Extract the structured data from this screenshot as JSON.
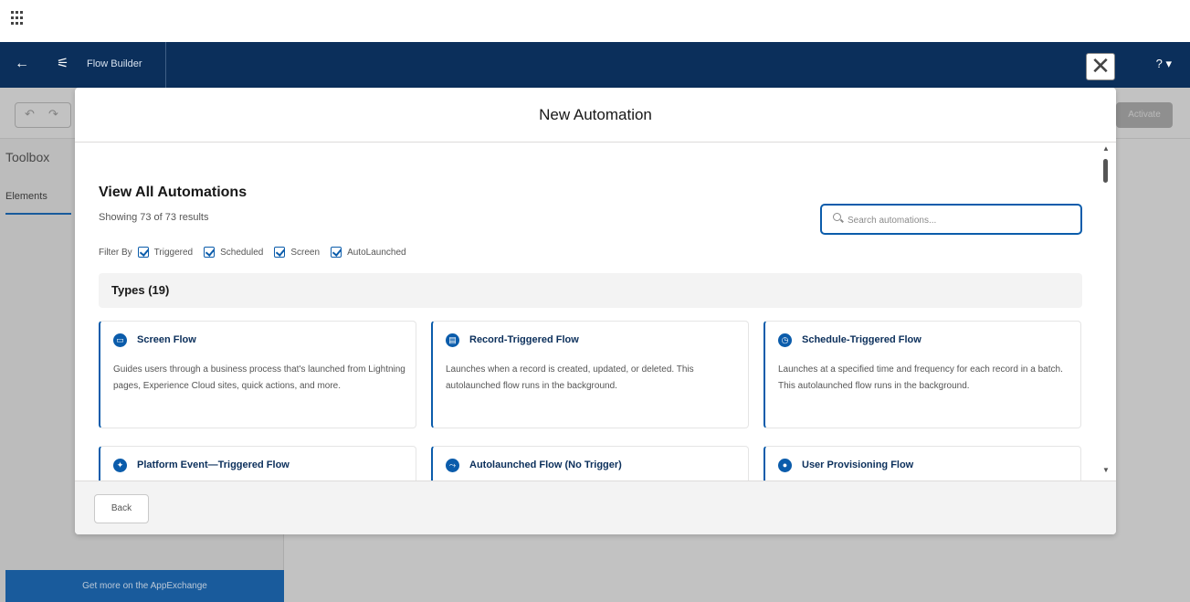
{
  "app": {
    "title": "Flow Builder",
    "back_icon": "←",
    "help_label": "? ▾"
  },
  "background": {
    "toolbox_label": "Toolbox",
    "elements_tab": "Elements",
    "appexchange_label": "Get more on the AppExchange",
    "activate_label": "Activate"
  },
  "modal": {
    "title": "New Automation",
    "close_label": "✕",
    "section_title": "View All Automations",
    "result_count": "Showing 73 of 73 results",
    "filter_label": "Filter By",
    "filters": [
      "Triggered",
      "Scheduled",
      "Screen",
      "AutoLaunched"
    ],
    "search": {
      "placeholder": "Search automations...",
      "value": ""
    },
    "types_label": "Types (19)",
    "cards": [
      {
        "title": "Screen Flow",
        "icon": "screen-flow-icon",
        "icon_glyph": "▭",
        "icon_color": "#0b5cab",
        "description": "Guides users through a business process that's launched from Lightning pages, Experience Cloud sites, quick actions, and more."
      },
      {
        "title": "Record-Triggered Flow",
        "icon": "record-triggered-icon",
        "icon_glyph": "▤",
        "icon_color": "#0b5cab",
        "description": "Launches when a record is created, updated, or deleted. This autolaunched flow runs in the background."
      },
      {
        "title": "Schedule-Triggered Flow",
        "icon": "schedule-triggered-icon",
        "icon_glyph": "◷",
        "icon_color": "#0b5cab",
        "description": "Launches at a specified time and frequency for each record in a batch. This autolaunched flow runs in the background."
      },
      {
        "title": "Platform Event—Triggered Flow",
        "icon": "platform-event-icon",
        "icon_glyph": "✦",
        "icon_color": "#0b5cab",
        "description": ""
      },
      {
        "title": "Autolaunched Flow (No Trigger)",
        "icon": "autolaunched-icon",
        "icon_glyph": "⤳",
        "icon_color": "#0b5cab",
        "description": ""
      },
      {
        "title": "User Provisioning Flow",
        "icon": "user-provisioning-icon",
        "icon_glyph": "●",
        "icon_color": "#0b5cab",
        "description": ""
      }
    ],
    "back_button": "Back"
  },
  "colors": {
    "header_bg": "#0b2f5b",
    "accent": "#0b5cab"
  }
}
